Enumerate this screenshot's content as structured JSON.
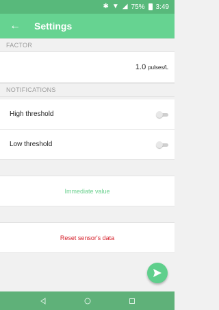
{
  "status_bar": {
    "battery": "75%",
    "time": "3:49",
    "icons": [
      "bluetooth-icon",
      "wifi-icon",
      "signal-icon",
      "battery-icon"
    ]
  },
  "app_bar": {
    "title": "Settings",
    "back_icon": "arrow-left-icon"
  },
  "sections": {
    "factor_header": "FACTOR",
    "notifications_header": "NOTIFICATIONS"
  },
  "factor": {
    "value": "1.0",
    "unit": "pulses/L"
  },
  "notifications": {
    "high_threshold_label": "High threshold",
    "high_threshold_on": false,
    "low_threshold_label": "Low threshold",
    "low_threshold_on": false
  },
  "actions": {
    "immediate_value": "Immediate value",
    "reset_sensor": "Reset sensor's data"
  },
  "fab": {
    "icon": "send-icon"
  },
  "nav_bar": {
    "icons": [
      "back-triangle-icon",
      "home-circle-icon",
      "recents-square-icon"
    ]
  },
  "colors": {
    "status_bar": "#58b97b",
    "app_bar": "#66d391",
    "accent": "#6ad08e",
    "reset": "#d6202b",
    "nav_bar": "#5fb179"
  }
}
